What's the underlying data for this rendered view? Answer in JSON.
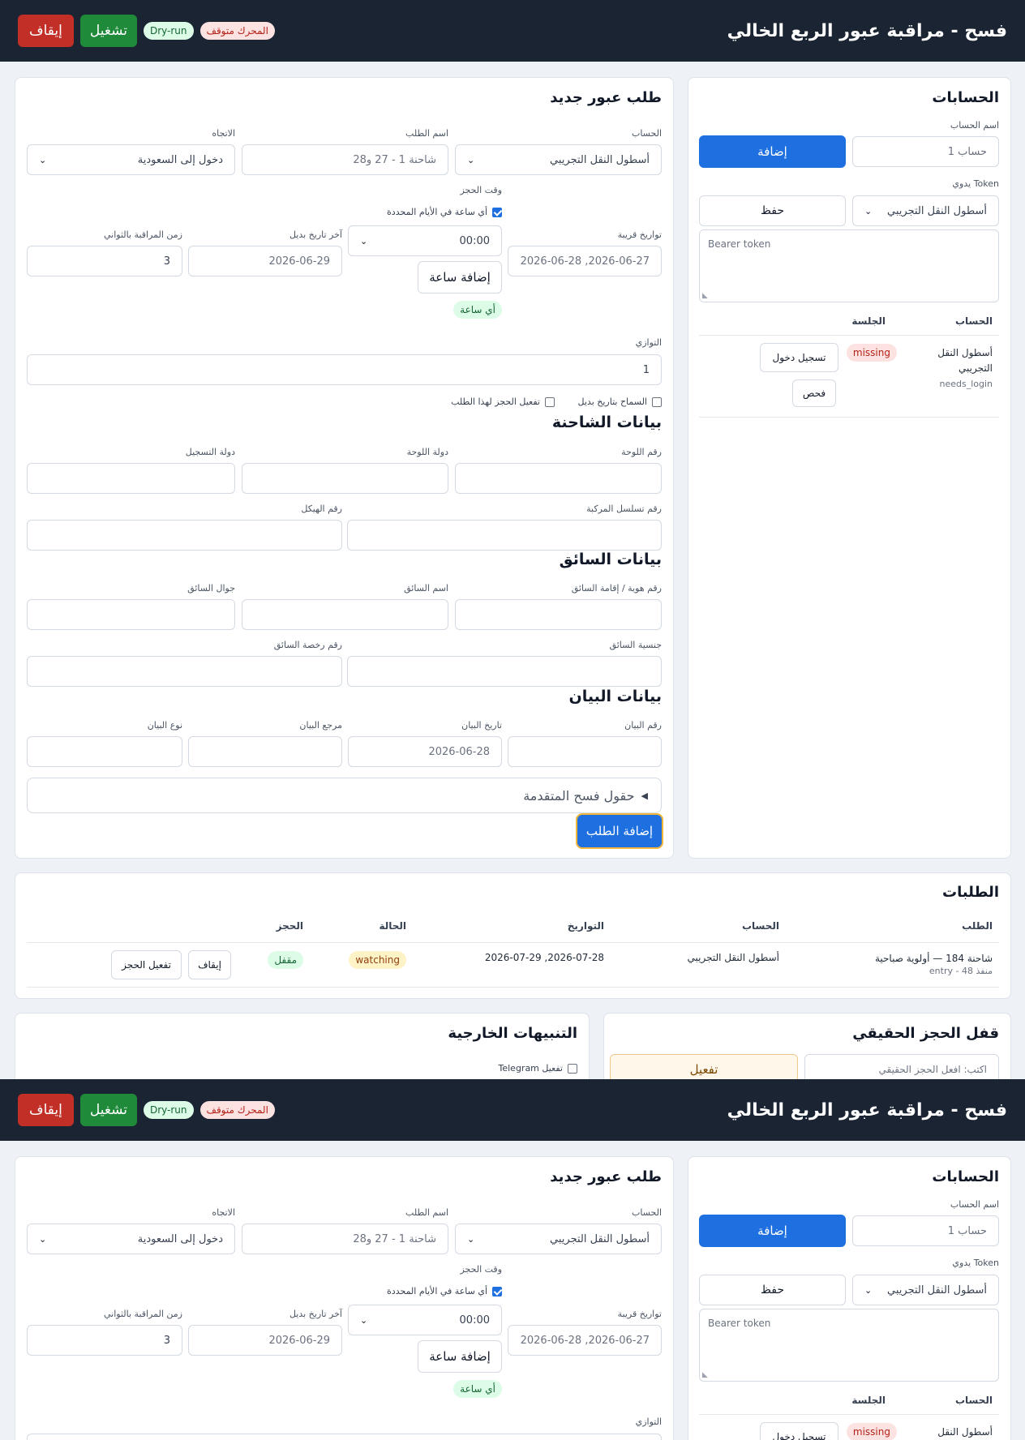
{
  "header": {
    "title": "فسح - مراقبة عبور الربع الخالي",
    "stop_label": "إيقاف",
    "run_label": "تشغيل",
    "dry_run_badge": "Dry-run",
    "engine_status": "المحرك متوقف"
  },
  "accounts": {
    "title": "الحسابات",
    "name_label": "اسم الحساب",
    "name_placeholder": "حساب 1",
    "add_label": "إضافة",
    "token_label": "Token يدوي",
    "token_account_value": "أسطول النقل التجريبي",
    "save_label": "حفظ",
    "token_placeholder": "Bearer token",
    "columns": {
      "account": "الحساب",
      "session": "الجلسة"
    },
    "rows": [
      {
        "name_line1": "أسطول النقل",
        "name_line2": "التجريبي",
        "state": "needs_login",
        "session": "missing",
        "login_label": "تسجيل دخول",
        "check_label": "فحص"
      }
    ]
  },
  "new_request": {
    "title": "طلب عبور جديد",
    "account_label": "الحساب",
    "account_value": "أسطول النقل التجريبي",
    "request_name_label": "اسم الطلب",
    "request_name_placeholder": "شاحنة 1 - 27 و28",
    "direction_label": "الاتجاه",
    "direction_value": "دخول إلى السعودية",
    "booking_time_label": "وقت الحجز",
    "any_hour_label": "أي ساعة في الأيام المحددة",
    "nearby_dates_label": "تواريخ قريبة",
    "nearby_dates_placeholder": "2026-06-27, 2026-06-28",
    "time_value": "00:00",
    "add_hour_label": "إضافة ساعة",
    "any_hour_tag": "أي ساعة",
    "last_alt_date_label": "آخر تاريخ بديل",
    "last_alt_date_placeholder": "2026-06-29",
    "monitor_interval_label": "زمن المراقبة بالثواني",
    "monitor_interval_value": "3",
    "parallel_label": "التوازي",
    "parallel_value": "1",
    "allow_alt_date_label": "السماح بتاريخ بديل",
    "enable_booking_label": "تفعيل الحجز لهذا الطلب",
    "truck_section": "بيانات الشاحنة",
    "plate_number_label": "رقم اللوحة",
    "plate_country_label": "دولة اللوحة",
    "registration_country_label": "دولة التسجيل",
    "vehicle_serial_label": "رقم تسلسل المركبة",
    "chassis_label": "رقم الهيكل",
    "driver_section": "بيانات السائق",
    "driver_id_label": "رقم هوية / إقامة السائق",
    "driver_name_label": "اسم السائق",
    "driver_mobile_label": "جوال السائق",
    "driver_nationality_label": "جنسية السائق",
    "driver_license_label": "رقم رخصة السائق",
    "manifest_section": "بيانات البيان",
    "manifest_number_label": "رقم البيان",
    "manifest_date_label": "تاريخ البيان",
    "manifest_date_placeholder": "2026-06-28",
    "manifest_ref_label": "مرجع البيان",
    "manifest_type_label": "نوع البيان",
    "advanced_fields_label": "حقول فسح المتقدمة",
    "submit_label": "إضافة الطلب"
  },
  "requests": {
    "title": "الطلبات",
    "columns": {
      "request": "الطلب",
      "account": "الحساب",
      "dates": "التواريخ",
      "status": "الحالة",
      "booking": "الحجز"
    },
    "rows": [
      {
        "name": "شاحنة 184 — أولوية صباحية",
        "detail": "منفذ 48 - entry",
        "account": "أسطول النقل التجريبي",
        "dates": "2026-07-28, 2026-07-29",
        "status": "watching",
        "booking": "مقفل",
        "stop_label": "إيقاف",
        "enable_booking_label": "تفعيل الحجز"
      }
    ]
  },
  "real_lock": {
    "title": "قفل الحجز الحقيقي",
    "placeholder": "اكتب: افعل الحجز الحقيقي",
    "activate_label": "تفعيل"
  },
  "external_alerts": {
    "title": "التنبيهات الخارجية",
    "telegram_label": "تفعيل Telegram"
  }
}
